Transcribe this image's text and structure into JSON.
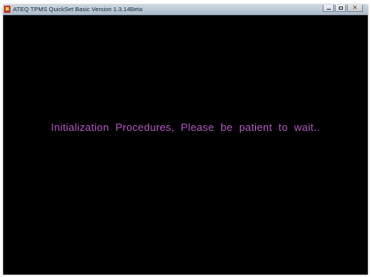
{
  "window": {
    "title": "ATEQ TPMS QuickSet Basic Version 1.3.14Beta",
    "icon": "app-icon",
    "buttons": {
      "minimize_icon": "minimize-icon",
      "maximize_icon": "maximize-icon",
      "close_icon": "close-icon",
      "close_glyph": "✕"
    }
  },
  "main": {
    "message": "Initialization Procedures, Please be patient to wait..",
    "background_color": "#000000",
    "message_color": "#b25bc0"
  }
}
